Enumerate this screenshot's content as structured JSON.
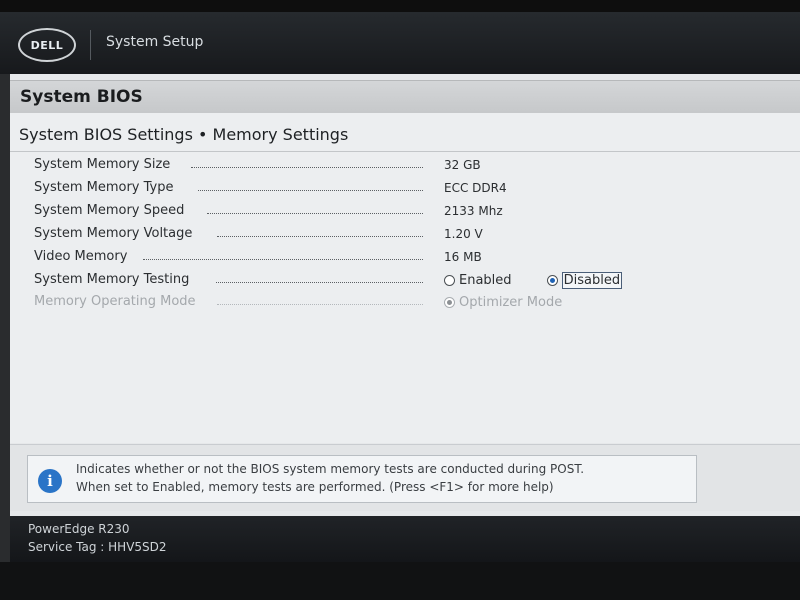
{
  "header": {
    "logo_text": "DELL",
    "app_title": "System Setup"
  },
  "section": {
    "title": "System BIOS"
  },
  "page": {
    "heading": "System BIOS Settings • Memory Settings"
  },
  "settings": [
    {
      "label": "System Memory Size",
      "value": "32 GB"
    },
    {
      "label": "System Memory Type",
      "value": "ECC DDR4"
    },
    {
      "label": "System Memory Speed",
      "value": "2133 Mhz"
    },
    {
      "label": "System Memory Voltage",
      "value": "1.20 V"
    },
    {
      "label": "Video Memory",
      "value": "16 MB"
    },
    {
      "label": "System Memory Testing",
      "options": [
        "Enabled",
        "Disabled"
      ],
      "selected": "Disabled"
    },
    {
      "label": "Memory Operating Mode",
      "options": [
        "Optimizer Mode"
      ],
      "selected": "Optimizer Mode"
    }
  ],
  "help": {
    "line1": "Indicates whether or not the BIOS system memory tests are conducted during POST.",
    "line2": "When set to Enabled, memory tests are performed. (Press <F1> for more help)"
  },
  "footer": {
    "model": "PowerEdge R230",
    "service_tag": "Service Tag : HHV5SD2"
  },
  "colors": {
    "header_bg": "#17191c",
    "radio_selected": "#1f62b4",
    "info_icon": "#2a74c7"
  }
}
